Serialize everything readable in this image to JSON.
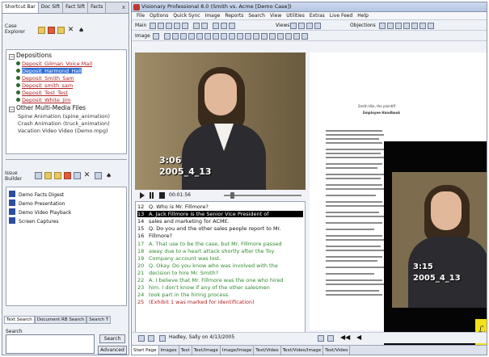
{
  "left_panel": {
    "tabs": [
      "Shortcut Bar",
      "Doc Sift",
      "Fact Sift",
      "Facts"
    ],
    "close": "x",
    "case_explorer_label": [
      "Case",
      "Explorer"
    ],
    "tree": {
      "group1": "Depositions",
      "items": [
        "Deposit_Gilman_Voice Mail",
        "Deposit_Harmond_Hall",
        "Deposit_Smith_Sam",
        "Deposit_smith_sam",
        "Deposit_Test_Test",
        "Deposit_White_Jim"
      ],
      "group2": "Other Multi-Media Files",
      "files": [
        "Spine Animation (spine_animation)",
        "Crash Animation (truck_animation)",
        "Vacation Video Video (Demo.mpg)"
      ]
    },
    "issue_builder_label": [
      "Issue",
      "Builder"
    ],
    "presentations": [
      "Demo Facts Digest",
      "Demo Presentation",
      "Demo Video Playback",
      "Screen Captures"
    ],
    "bottom_tabs": [
      "Text Search",
      "Document RB Search",
      "Search T"
    ],
    "search_label": "Search",
    "search_value": "",
    "search_button": "Search",
    "advanced_button": "Advanced"
  },
  "main": {
    "title": "Visionary Professional 8.0 (Smith vs. Acme [Demo Case])",
    "menu": [
      "File",
      "Options",
      "Quick Sync",
      "Image",
      "Reports",
      "Search",
      "View",
      "Utilities",
      "Extras",
      "Live Feed",
      "Help"
    ],
    "toolbar1": {
      "label1": "Main",
      "label2": "Views",
      "label3": "Objections"
    },
    "toolbar2": {
      "label1": "Image"
    },
    "video": {
      "time": "3:06",
      "date": "2005_4_13"
    },
    "timecode": "00:01:56",
    "transcript": [
      {
        "n": "12",
        "t": "Q.  Who is Mr. Fillmore?",
        "style": ""
      },
      {
        "n": "13",
        "t": "A.  Jack Fillmore is the Senior Vice President of",
        "style": "hl"
      },
      {
        "n": "14",
        "t": "sales and marketing for ACME.",
        "style": ""
      },
      {
        "n": "15",
        "t": "Q.  Do you and the other sales people report to Mr.",
        "style": ""
      },
      {
        "n": "16",
        "t": "Fillmore?",
        "style": ""
      },
      {
        "n": "17",
        "t": "A.  That use to be the case, but Mr. Fillmore passed",
        "style": "gr"
      },
      {
        "n": "18",
        "t": "away due to a heart attack shortly after the Toy",
        "style": "gr"
      },
      {
        "n": "19",
        "t": "Company account was lost.",
        "style": "gr"
      },
      {
        "n": "20",
        "t": "Q.  Okay.  Do you know who was involved with the",
        "style": "gr"
      },
      {
        "n": "21",
        "t": "decision to hire Mr. Smith?",
        "style": "gr"
      },
      {
        "n": "22",
        "t": "A.  I believe that Mr. Fillmore was the one who hired",
        "style": "gr"
      },
      {
        "n": "23",
        "t": "him.  I don't know if any of the other salesmen",
        "style": "gr"
      },
      {
        "n": "24",
        "t": "took part in the hiring process.",
        "style": "gr"
      },
      {
        "n": "25",
        "t": "(Exhibit 1 was marked for identification)",
        "style": "rd"
      }
    ],
    "status": "Hadley, Sally on 4/13/2005",
    "pip": {
      "time": "3:15",
      "date": "2005_4_13"
    },
    "doc": {
      "line1": "Smith Hile, the plaintiff",
      "line2": "Employee Handbook"
    },
    "bottom_tabs": [
      "Start Page",
      "Images",
      "Text",
      "Text/Image",
      "Image/Image",
      "Text/Video",
      "Text/Video/Image",
      "Text/Video"
    ]
  }
}
